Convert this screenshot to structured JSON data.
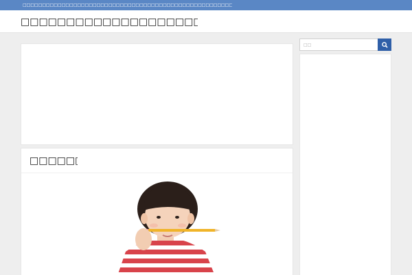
{
  "topbar": {
    "text": "□□□□□□□□□□□□□□□□□□□□□□□□□□□□□□□□□□□□□□□□□□□□□□□□□□□□□□□□□□□□□□□□□□□□□□□□□□□□□□□□□□□□□□□□□□□□□□□□□□□□□□□□□□□□□□□□□□□□□□□□□□□□□□□□□□□□□□□□□□□□",
    "bg_color": "#5a87c5"
  },
  "header": {
    "site_title": "□□□□□□□□□□□□□□□□□□□□□□□□□□/□□□/□□□□□□"
  },
  "article": {
    "title": "□□□□□□□□□□"
  },
  "search": {
    "placeholder": "□□",
    "button_icon": "search-icon",
    "button_color": "#2f5fa8"
  }
}
